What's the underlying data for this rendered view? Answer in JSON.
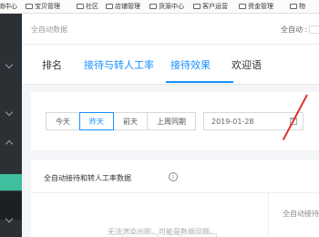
{
  "bookmarks": [
    {
      "label": "销中心"
    },
    {
      "label": "宝贝管理"
    },
    {
      "label": "社区"
    },
    {
      "label": "店铺管理"
    },
    {
      "label": "货源中心"
    },
    {
      "label": "客户运营"
    },
    {
      "label": "资金管理"
    },
    {
      "label": "物"
    }
  ],
  "header": {
    "title": "全自动数据",
    "right_label": "全自动 :"
  },
  "tabs": [
    {
      "label": "排名",
      "active": false
    },
    {
      "label": "接待与转人工率",
      "active": false
    },
    {
      "label": "接待效果",
      "active": true
    },
    {
      "label": "欢迎语",
      "active": false
    }
  ],
  "date_filter": {
    "options": [
      "今天",
      "昨天",
      "前天",
      "上周同期"
    ],
    "selected": "昨天",
    "date_value": "2019-01-28"
  },
  "data_card": {
    "title": "全自动接待和转人工率数据",
    "info": "i",
    "right_label": "全自动接待",
    "empty_message": "无法渲染出图，可能是数据问题。"
  },
  "colors": {
    "accent": "#1890ff",
    "sidebar": "#2b3035",
    "sidebar_active": "#3fbf9f",
    "annotation": "#e03030"
  }
}
